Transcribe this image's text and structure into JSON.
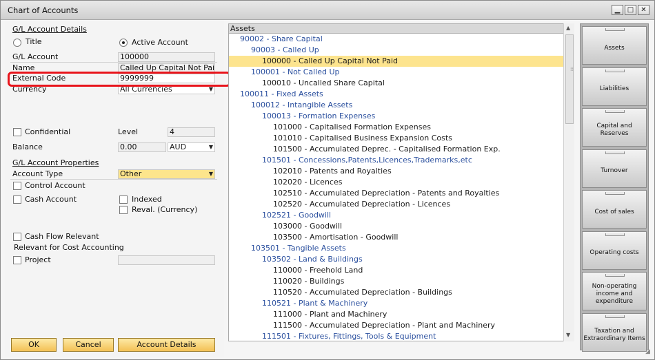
{
  "window": {
    "title": "Chart of Accounts"
  },
  "left": {
    "section_details": "G/L Account Details",
    "radio_title": "Title",
    "radio_active": "Active Account",
    "gl_account_label": "G/L Account",
    "gl_account_value": "100000",
    "name_label": "Name",
    "name_value": "Called Up Capital Not Paid",
    "external_code_label": "External Code",
    "external_code_value": "9999999",
    "currency_label": "Currency",
    "currency_value": "All Currencies",
    "confidential_label": "Confidential",
    "level_label": "Level",
    "level_value": "4",
    "balance_label": "Balance",
    "balance_value": "0.00",
    "balance_currency": "AUD",
    "section_properties": "G/L Account Properties",
    "account_type_label": "Account Type",
    "account_type_value": "Other",
    "control_account": "Control Account",
    "cash_account": "Cash Account",
    "indexed": "Indexed",
    "reval": "Reval. (Currency)",
    "cash_flow": "Cash Flow Relevant",
    "cost_accounting": "Relevant for Cost Accounting",
    "project": "Project"
  },
  "buttons": {
    "ok": "OK",
    "cancel": "Cancel",
    "account_details": "Account Details"
  },
  "tree": {
    "header": "Assets",
    "rows": [
      {
        "text": "90002 - Share Capital",
        "level": 1,
        "kind": "blue"
      },
      {
        "text": "90003 - Called Up",
        "level": 2,
        "kind": "blue"
      },
      {
        "text": "100000 - Called Up Capital Not Paid",
        "level": 3,
        "kind": "sel"
      },
      {
        "text": "100001 - Not Called Up",
        "level": 2,
        "kind": "blue"
      },
      {
        "text": "100010 - Uncalled Share Capital",
        "level": 3,
        "kind": "dark"
      },
      {
        "text": "100011 - Fixed Assets",
        "level": 1,
        "kind": "blue"
      },
      {
        "text": "100012 - Intangible Assets",
        "level": 2,
        "kind": "blue"
      },
      {
        "text": "100013 - Formation Expenses",
        "level": 3,
        "kind": "blue"
      },
      {
        "text": "101000 - Capitalised Formation Expenses",
        "level": 4,
        "kind": "dark"
      },
      {
        "text": "101010 - Capitalised Business Expansion Costs",
        "level": 4,
        "kind": "dark"
      },
      {
        "text": "101500 - Accumulated Deprec. - Capitalised Formation Exp.",
        "level": 4,
        "kind": "dark"
      },
      {
        "text": "101501 - Concessions,Patents,Licences,Trademarks,etc",
        "level": 3,
        "kind": "blue"
      },
      {
        "text": "102010 - Patents and Royalties",
        "level": 4,
        "kind": "dark"
      },
      {
        "text": "102020 - Licences",
        "level": 4,
        "kind": "dark"
      },
      {
        "text": "102510 - Accumulated Depreciation - Patents and Royalties",
        "level": 4,
        "kind": "dark"
      },
      {
        "text": "102520 - Accumulated Depreciation - Licences",
        "level": 4,
        "kind": "dark"
      },
      {
        "text": "102521 - Goodwill",
        "level": 3,
        "kind": "blue"
      },
      {
        "text": "103000 - Goodwill",
        "level": 4,
        "kind": "dark"
      },
      {
        "text": "103500 - Amortisation - Goodwill",
        "level": 4,
        "kind": "dark"
      },
      {
        "text": "103501 - Tangible Assets",
        "level": 2,
        "kind": "blue"
      },
      {
        "text": "103502 - Land & Buildings",
        "level": 3,
        "kind": "blue"
      },
      {
        "text": "110000 - Freehold Land",
        "level": 4,
        "kind": "dark"
      },
      {
        "text": "110020 - Buildings",
        "level": 4,
        "kind": "dark"
      },
      {
        "text": "110520 - Accumulated Depreciation - Buildings",
        "level": 4,
        "kind": "dark"
      },
      {
        "text": "110521 - Plant & Machinery",
        "level": 3,
        "kind": "blue"
      },
      {
        "text": "111000 - Plant and Machinery",
        "level": 4,
        "kind": "dark"
      },
      {
        "text": "111500 - Accumulated Depreciation - Plant and Machinery",
        "level": 4,
        "kind": "dark"
      },
      {
        "text": "111501 - Fixtures, Fittings, Tools & Equipment",
        "level": 3,
        "kind": "blue"
      }
    ]
  },
  "drawers": [
    "Assets",
    "Liabilities",
    "Capital and Reserves",
    "Turnover",
    "Cost of sales",
    "Operating costs",
    "Non-operating income and expenditure",
    "Taxation and Extraordinary Items"
  ],
  "colors": {
    "highlight": "#e8141b",
    "selection": "#fde48e",
    "tree_blue": "#2a4f9e",
    "button": "#f3c155"
  }
}
